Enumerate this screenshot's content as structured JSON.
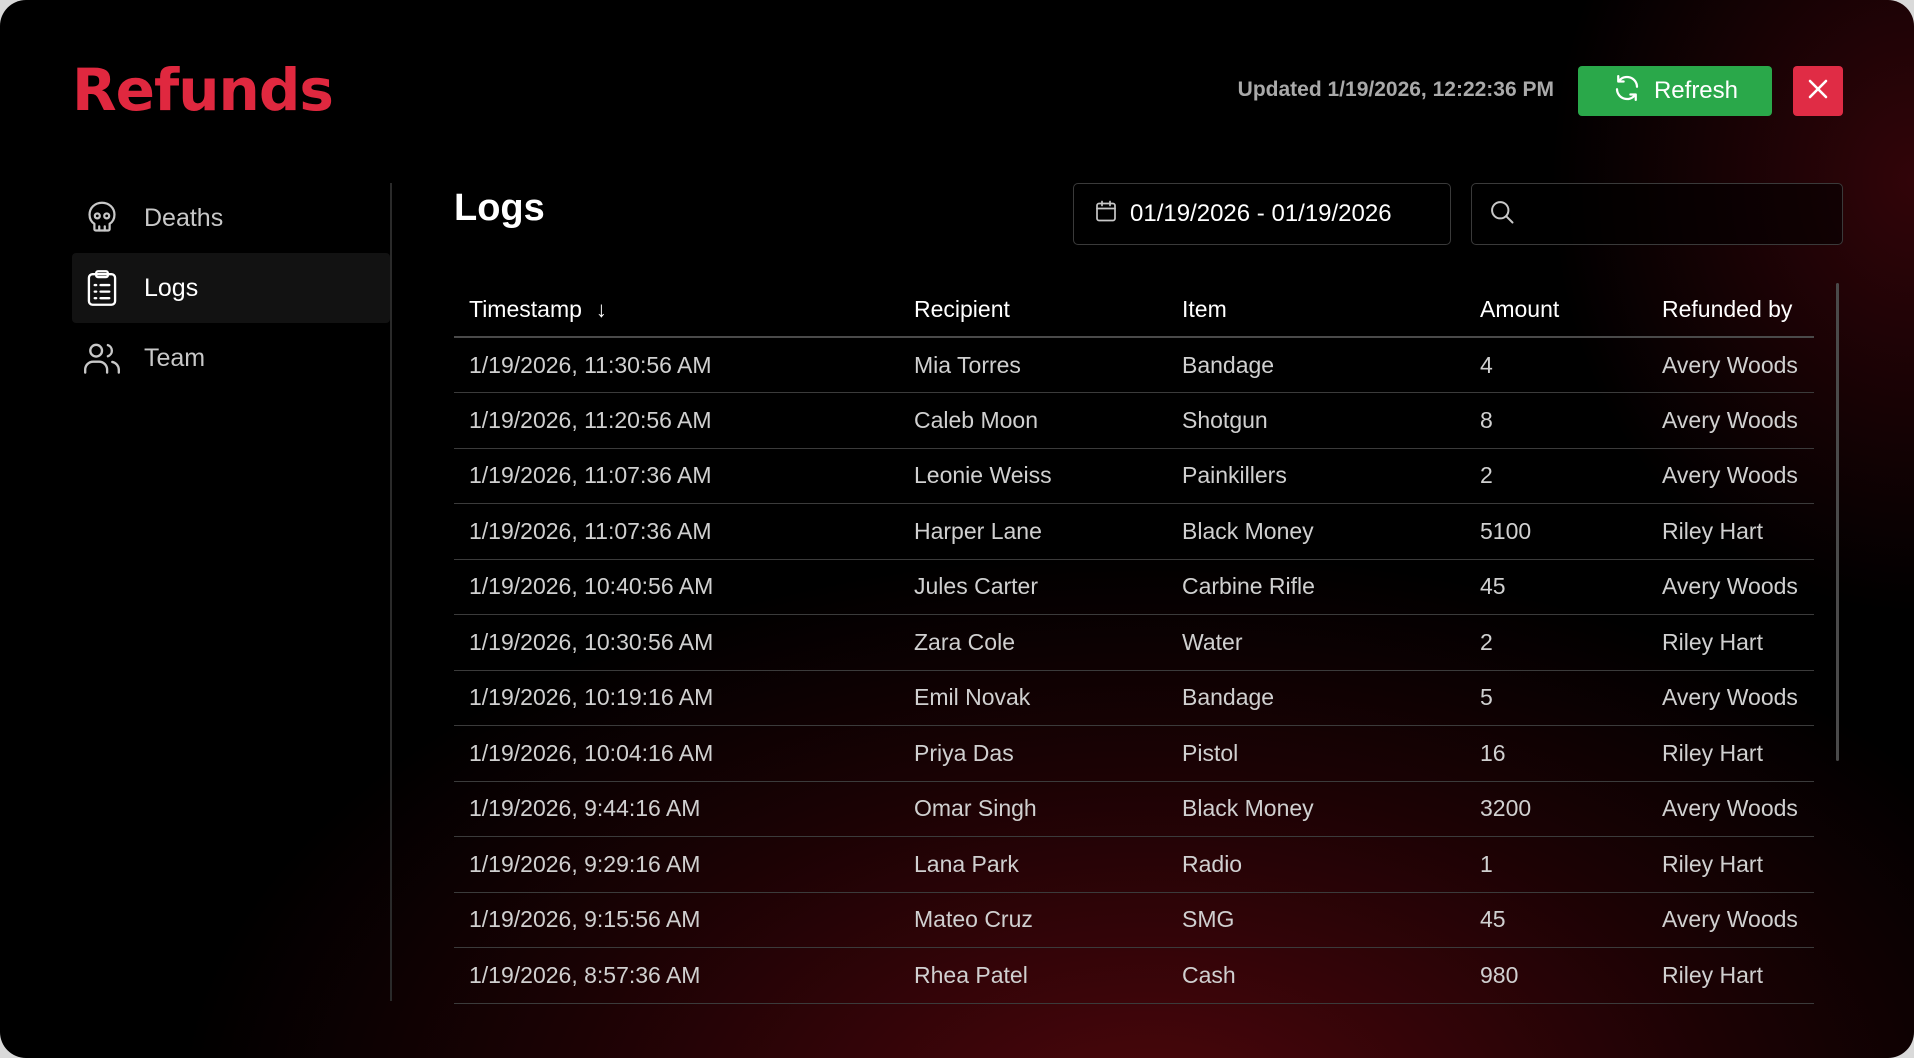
{
  "app": {
    "title": "Refunds"
  },
  "header": {
    "updated": "Updated 1/19/2026, 12:22:36 PM",
    "refresh_label": "Refresh",
    "close_label": "✕"
  },
  "sidebar": {
    "items": [
      {
        "label": "Deaths",
        "icon": "skull-icon",
        "active": false
      },
      {
        "label": "Logs",
        "icon": "clipboard-list-icon",
        "active": true
      },
      {
        "label": "Team",
        "icon": "users-icon",
        "active": false
      }
    ]
  },
  "main": {
    "title": "Logs",
    "date_range": "01/19/2026 - 01/19/2026",
    "search": {
      "value": "",
      "placeholder": ""
    }
  },
  "table": {
    "columns": [
      "Timestamp",
      "Recipient",
      "Item",
      "Amount",
      "Refunded by"
    ],
    "sort_indicator": "↓",
    "rows": [
      [
        "1/19/2026, 11:30:56 AM",
        "Mia Torres",
        "Bandage",
        "4",
        "Avery Woods"
      ],
      [
        "1/19/2026, 11:20:56 AM",
        "Caleb Moon",
        "Shotgun",
        "8",
        "Avery Woods"
      ],
      [
        "1/19/2026, 11:07:36 AM",
        "Leonie Weiss",
        "Painkillers",
        "2",
        "Avery Woods"
      ],
      [
        "1/19/2026, 11:07:36 AM",
        "Harper Lane",
        "Black Money",
        "5100",
        "Riley Hart"
      ],
      [
        "1/19/2026, 10:40:56 AM",
        "Jules Carter",
        "Carbine Rifle",
        "45",
        "Avery Woods"
      ],
      [
        "1/19/2026, 10:30:56 AM",
        "Zara Cole",
        "Water",
        "2",
        "Riley Hart"
      ],
      [
        "1/19/2026, 10:19:16 AM",
        "Emil Novak",
        "Bandage",
        "5",
        "Avery Woods"
      ],
      [
        "1/19/2026, 10:04:16 AM",
        "Priya Das",
        "Pistol",
        "16",
        "Riley Hart"
      ],
      [
        "1/19/2026, 9:44:16 AM",
        "Omar Singh",
        "Black Money",
        "3200",
        "Avery Woods"
      ],
      [
        "1/19/2026, 9:29:16 AM",
        "Lana Park",
        "Radio",
        "1",
        "Riley Hart"
      ],
      [
        "1/19/2026, 9:15:56 AM",
        "Mateo Cruz",
        "SMG",
        "45",
        "Avery Woods"
      ],
      [
        "1/19/2026, 8:57:36 AM",
        "Rhea Patel",
        "Cash",
        "980",
        "Riley Hart"
      ]
    ]
  },
  "colors": {
    "brand": "#e0283f",
    "refresh": "#2aa84a",
    "close": "#e02c45",
    "background": "#000000"
  }
}
